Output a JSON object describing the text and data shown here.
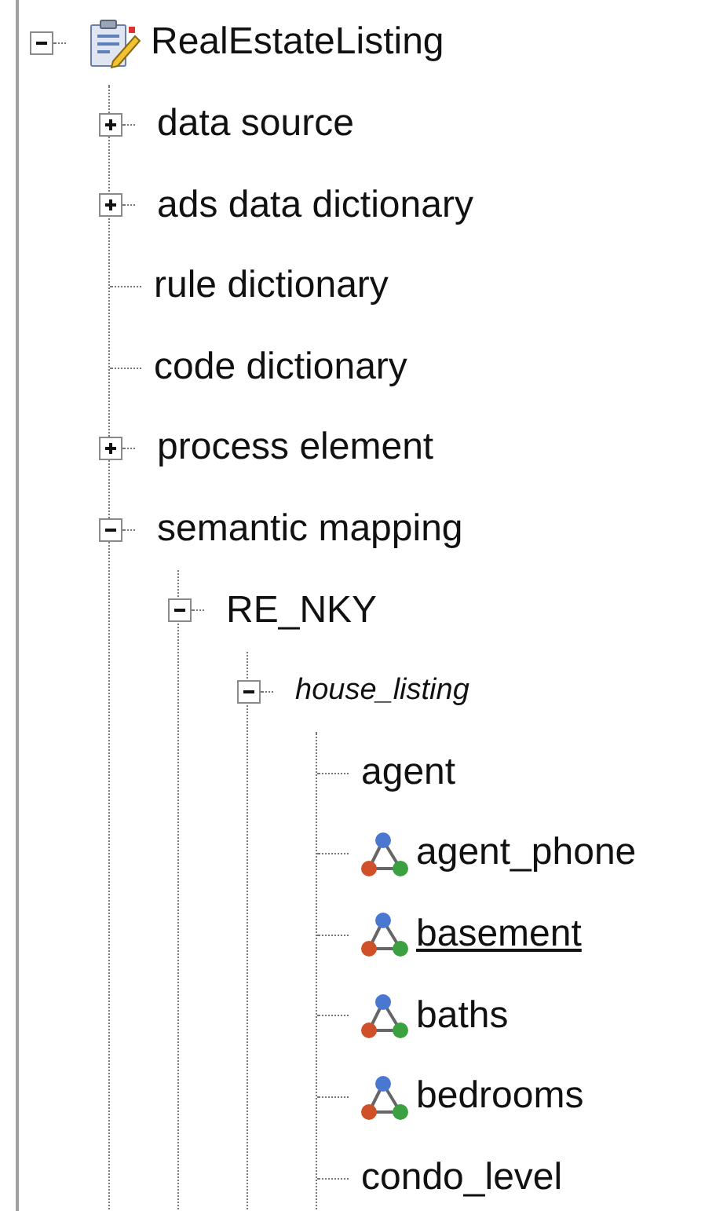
{
  "tree": {
    "label": "RealEstateListing",
    "kind": "document",
    "expanded": true,
    "children": [
      {
        "label": "data source",
        "kind": "branch",
        "expanded": false
      },
      {
        "label": "ads data dictionary",
        "kind": "branch",
        "expanded": false
      },
      {
        "label": "rule dictionary",
        "kind": "leaf"
      },
      {
        "label": "code dictionary",
        "kind": "leaf"
      },
      {
        "label": "process element",
        "kind": "branch",
        "expanded": false
      },
      {
        "label": "semantic mapping",
        "kind": "branch",
        "expanded": true,
        "children": [
          {
            "label": "RE_NKY",
            "kind": "branch",
            "expanded": true,
            "children": [
              {
                "label": "house_listing",
                "kind": "branch",
                "expanded": true,
                "italic": true,
                "children": [
                  {
                    "label": "agent",
                    "kind": "leaf",
                    "underlined": false
                  },
                  {
                    "label": "agent_phone",
                    "kind": "relation",
                    "underlined": false
                  },
                  {
                    "label": "basement",
                    "kind": "relation",
                    "underlined": true
                  },
                  {
                    "label": "baths",
                    "kind": "relation",
                    "underlined": false
                  },
                  {
                    "label": "bedrooms",
                    "kind": "relation",
                    "underlined": false
                  },
                  {
                    "label": "condo_level",
                    "kind": "leaf",
                    "underlined": false
                  }
                ]
              }
            ]
          }
        ]
      }
    ]
  }
}
